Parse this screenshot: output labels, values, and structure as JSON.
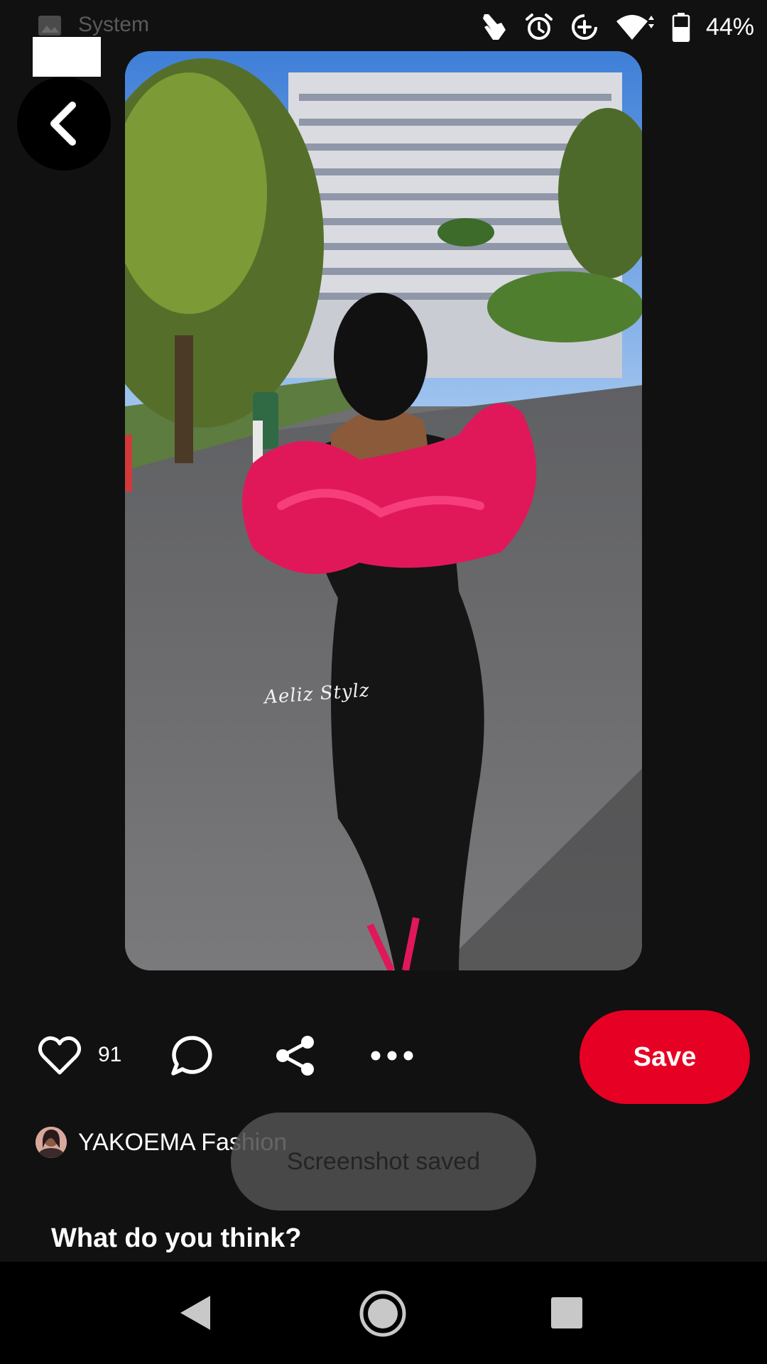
{
  "status_bar": {
    "app_label": "System",
    "battery_percent": "44%",
    "icons": [
      "image-icon",
      "touch-icon",
      "alarm-icon",
      "data-saver-icon",
      "wifi-icon",
      "battery-icon"
    ]
  },
  "pin": {
    "watermark": "Aeliz Stylz",
    "like_count": "91",
    "save_label": "Save",
    "author_name": "YAKOEMA Fashion",
    "prompt": "What do you think?"
  },
  "toast": {
    "text": "Screenshot saved"
  },
  "colors": {
    "background": "#111111",
    "save_button": "#e60023",
    "toast_bg": "#505050",
    "nav_bar": "#000000"
  },
  "nav_bar": {
    "icons": [
      "back-icon",
      "home-icon",
      "recents-icon"
    ]
  }
}
